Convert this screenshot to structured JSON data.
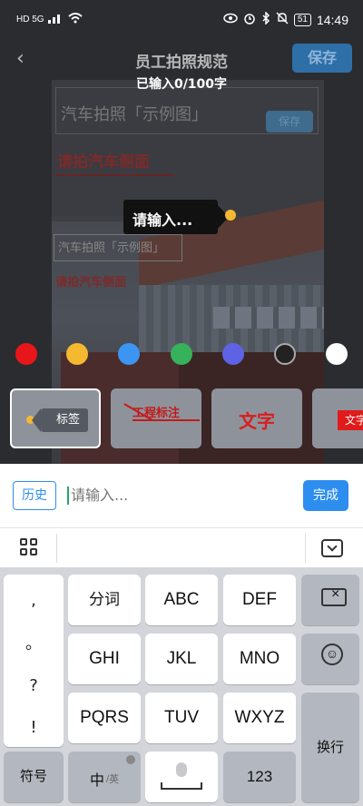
{
  "status_bar": {
    "network": "HD 5G",
    "battery": "51",
    "time": "14:49"
  },
  "header": {
    "title": "员工拍照规范",
    "save_label": "保存",
    "char_count": "已输入0/100字"
  },
  "background": {
    "title": "汽车拍照「示例图」",
    "save_label": "保存",
    "red_text": "请拍汽车侧面",
    "label_title": "汽车拍照「示例图」",
    "red_text_2": "请拍汽车侧面"
  },
  "annotation": {
    "text": "请输入..."
  },
  "colors": [
    {
      "name": "red",
      "hex": "#e8161a"
    },
    {
      "name": "yellow",
      "hex": "#f5b931"
    },
    {
      "name": "blue",
      "hex": "#3c95f3"
    },
    {
      "name": "green",
      "hex": "#36b25b"
    },
    {
      "name": "purple",
      "hex": "#5e62e4"
    },
    {
      "name": "black",
      "hex": "#222222"
    },
    {
      "name": "white",
      "hex": "#ffffff"
    }
  ],
  "styles": {
    "tag_label": "标签",
    "engineering_label": "工程标注",
    "text_label": "文字",
    "red_label": "文字"
  },
  "input_bar": {
    "history_label": "历史",
    "placeholder": "请输入...",
    "done_label": "完成"
  },
  "keyboard": {
    "punctuation": [
      ",",
      "。",
      "?",
      "!"
    ],
    "row1": [
      "分词",
      "ABC",
      "DEF"
    ],
    "row2": [
      "GHI",
      "JKL",
      "MNO"
    ],
    "row3": [
      "PQRS",
      "TUV",
      "WXYZ"
    ],
    "symbol_label": "符号",
    "lang_main": "中",
    "lang_sub": "/英",
    "num_label": "123",
    "enter_label": "换行"
  }
}
